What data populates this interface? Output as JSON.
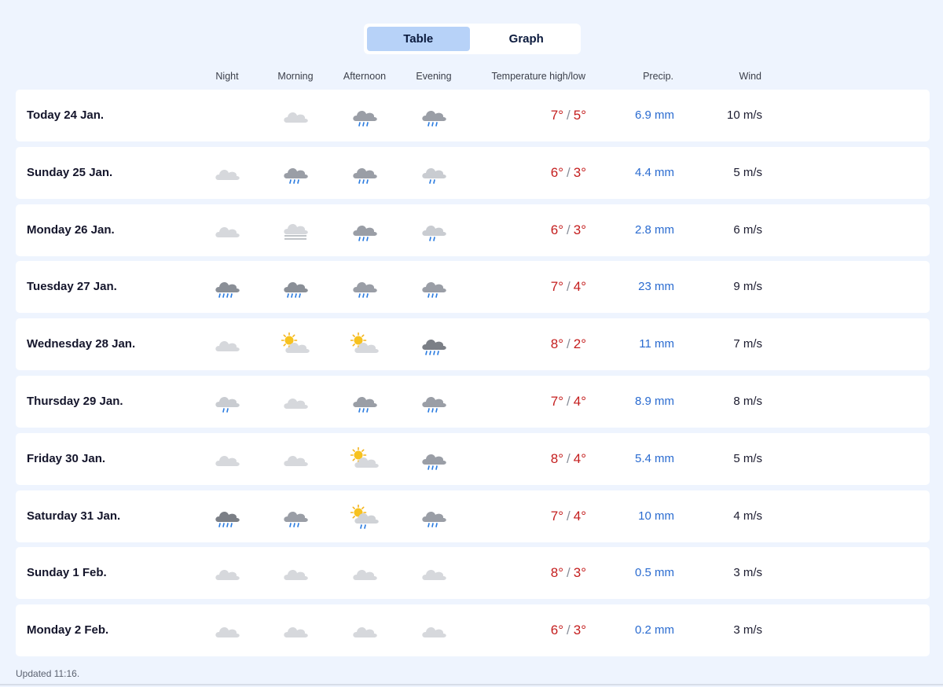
{
  "view_toggle": {
    "table_label": "Table",
    "graph_label": "Graph",
    "active": "Table"
  },
  "columns": {
    "night": "Night",
    "morning": "Morning",
    "afternoon": "Afternoon",
    "evening": "Evening",
    "temp": "Temperature high/low",
    "precip": "Precip.",
    "wind": "Wind"
  },
  "temp_separator": "/",
  "colors": {
    "temp": "#c41d1d",
    "precip": "#2a6bd0",
    "active_toggle": "#b7d2f8",
    "background": "#eef4fe"
  },
  "rows": [
    {
      "day": "Today 24 Jan.",
      "night": "",
      "morning": "cloud-icon",
      "afternoon": "cloud-rain-icon",
      "evening": "cloud-rain-icon",
      "high": "7°",
      "low": "5°",
      "precip": "6.9 mm",
      "wind": "10 m/s"
    },
    {
      "day": "Sunday 25 Jan.",
      "night": "cloud-icon",
      "morning": "cloud-rain-icon",
      "afternoon": "cloud-rain-icon",
      "evening": "light-cloud-light-rain-icon",
      "high": "6°",
      "low": "3°",
      "precip": "4.4 mm",
      "wind": "5 m/s"
    },
    {
      "day": "Monday 26 Jan.",
      "night": "cloud-icon",
      "morning": "fog-icon",
      "afternoon": "cloud-rain-icon",
      "evening": "light-cloud-light-rain-icon",
      "high": "6°",
      "low": "3°",
      "precip": "2.8 mm",
      "wind": "6 m/s"
    },
    {
      "day": "Tuesday 27 Jan.",
      "night": "cloud-heavy-rain-icon",
      "morning": "cloud-heavy-rain-icon",
      "afternoon": "cloud-rain-icon",
      "evening": "cloud-rain-icon",
      "high": "7°",
      "low": "4°",
      "precip": "23 mm",
      "wind": "9 m/s"
    },
    {
      "day": "Wednesday 28 Jan.",
      "night": "cloud-icon",
      "morning": "partly-sunny-icon",
      "afternoon": "partly-sunny-icon",
      "evening": "dark-cloud-heavy-rain-icon",
      "high": "8°",
      "low": "2°",
      "precip": "11 mm",
      "wind": "7 m/s"
    },
    {
      "day": "Thursday 29 Jan.",
      "night": "light-cloud-light-rain-icon",
      "morning": "cloud-icon",
      "afternoon": "cloud-rain-icon",
      "evening": "cloud-rain-icon",
      "high": "7°",
      "low": "4°",
      "precip": "8.9 mm",
      "wind": "8 m/s"
    },
    {
      "day": "Friday 30 Jan.",
      "night": "cloud-icon",
      "morning": "cloud-icon",
      "afternoon": "partly-sunny-icon",
      "evening": "cloud-rain-icon",
      "high": "8°",
      "low": "4°",
      "precip": "5.4 mm",
      "wind": "5 m/s"
    },
    {
      "day": "Saturday 31 Jan.",
      "night": "dark-cloud-heavy-rain-icon",
      "morning": "cloud-rain-icon",
      "afternoon": "partly-sunny-rain-icon",
      "evening": "cloud-rain-icon",
      "high": "7°",
      "low": "4°",
      "precip": "10 mm",
      "wind": "4 m/s"
    },
    {
      "day": "Sunday 1 Feb.",
      "night": "cloud-icon",
      "morning": "cloud-icon",
      "afternoon": "cloud-icon",
      "evening": "cloud-icon",
      "high": "8°",
      "low": "3°",
      "precip": "0.5 mm",
      "wind": "3 m/s"
    },
    {
      "day": "Monday 2 Feb.",
      "night": "cloud-icon",
      "morning": "cloud-icon",
      "afternoon": "cloud-icon",
      "evening": "cloud-icon",
      "high": "6°",
      "low": "3°",
      "precip": "0.2 mm",
      "wind": "3 m/s"
    }
  ],
  "updated": "Updated 11:16."
}
